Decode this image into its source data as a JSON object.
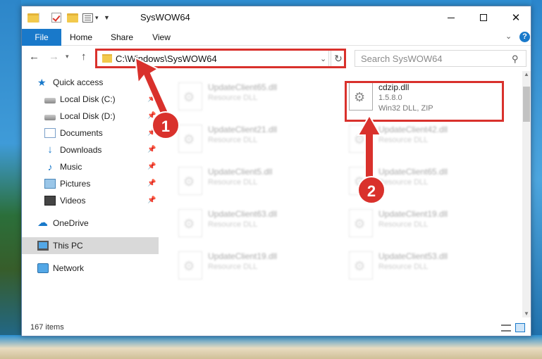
{
  "window": {
    "title": "SysWOW64"
  },
  "ribbon": {
    "tabs": [
      "File",
      "Home",
      "Share",
      "View"
    ]
  },
  "address": {
    "path": "C:\\Windows\\SysWOW64",
    "search_placeholder": "Search SysWOW64"
  },
  "nav": {
    "items": [
      {
        "label": "Quick access"
      },
      {
        "label": "Local Disk (C:)"
      },
      {
        "label": "Local Disk (D:)"
      },
      {
        "label": "Documents"
      },
      {
        "label": "Downloads"
      },
      {
        "label": "Music"
      },
      {
        "label": "Pictures"
      },
      {
        "label": "Videos"
      },
      {
        "label": "OneDrive"
      },
      {
        "label": "This PC"
      },
      {
        "label": "Network"
      }
    ]
  },
  "files": [
    {
      "name": "UpdateClient65.dll",
      "type": "Resource DLL"
    },
    {
      "name": "cdzip.dll",
      "version": "1.5.8.0",
      "type": "Win32 DLL, ZIP"
    },
    {
      "name": "UpdateClient21.dll",
      "type": "Resource DLL"
    },
    {
      "name": "UpdateClient42.dll",
      "type": "Resource DLL"
    },
    {
      "name": "UpdateClient5.dll",
      "type": "Resource DLL"
    },
    {
      "name": "UpdateClient65.dll",
      "type": "Resource DLL"
    },
    {
      "name": "UpdateClient63.dll",
      "type": "Resource DLL"
    },
    {
      "name": "UpdateClient19.dll",
      "type": "Resource DLL"
    },
    {
      "name": "UpdateClient19.dll",
      "type": "Resource DLL"
    },
    {
      "name": "UpdateClient53.dll",
      "type": "Resource DLL"
    }
  ],
  "status": {
    "item_count": "167 items"
  },
  "annotations": {
    "step1": "1",
    "step2": "2",
    "color": "#d9312c"
  }
}
